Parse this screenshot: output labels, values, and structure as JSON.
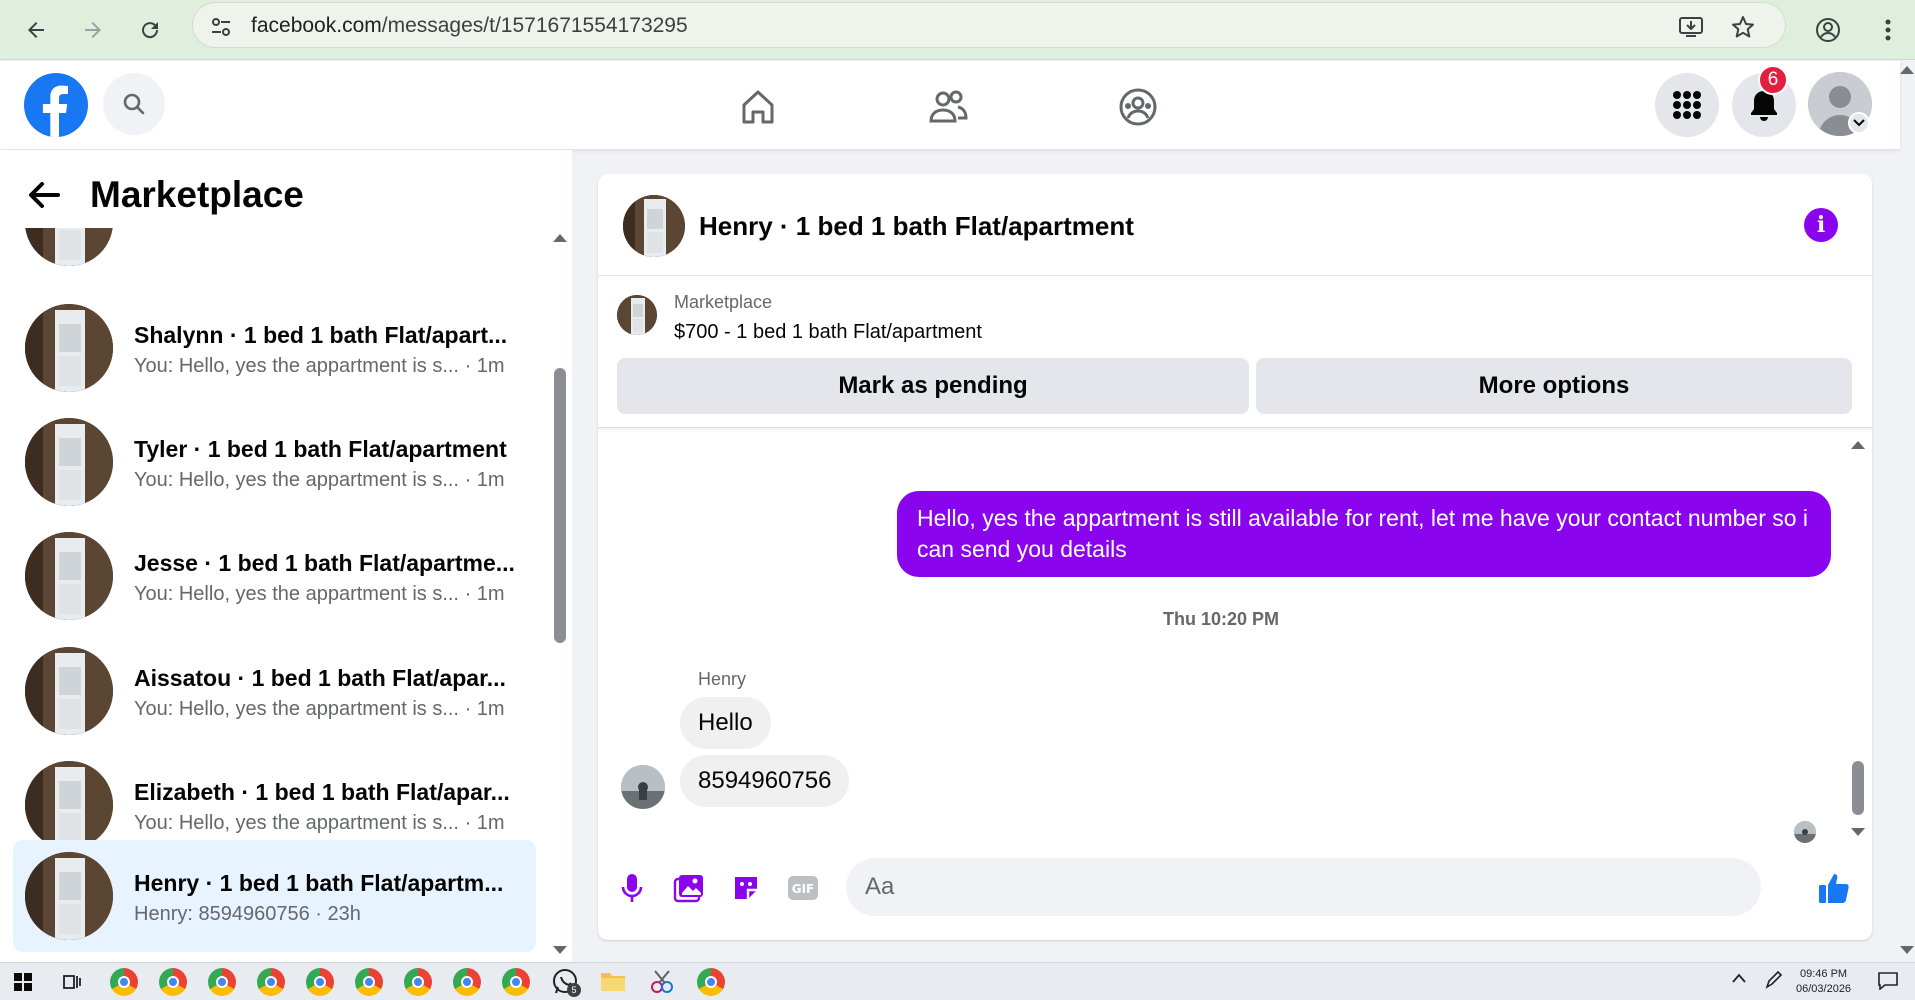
{
  "browser": {
    "url_host": "facebook.com",
    "url_path": "/messages/t/1571671554173295"
  },
  "header": {
    "notification_count": "6"
  },
  "left_panel": {
    "title": "Marketplace",
    "conversations": [
      {
        "name": "Shalynn · 1 bed 1 bath Flat/apart...",
        "preview": "You: Hello, yes the appartment is s...",
        "time": "· 1m"
      },
      {
        "name": "Tyler · 1 bed 1 bath Flat/apartment",
        "preview": "You: Hello, yes the appartment is s...",
        "time": "· 1m"
      },
      {
        "name": "Jesse · 1 bed 1 bath Flat/apartme...",
        "preview": "You: Hello, yes the appartment is s...",
        "time": "· 1m"
      },
      {
        "name": "Aissatou · 1 bed 1 bath Flat/apar...",
        "preview": "You: Hello, yes the appartment is s...",
        "time": "· 1m"
      },
      {
        "name": "Elizabeth · 1 bed 1 bath Flat/apar...",
        "preview": "You: Hello, yes the appartment is s...",
        "time": "· 1m"
      },
      {
        "name": "Henry · 1 bed 1 bath Flat/apartm...",
        "preview": "Henry: 8594960756",
        "time": "· 23h"
      }
    ]
  },
  "chat": {
    "title": "Henry · 1 bed 1 bath Flat/apartment",
    "marketplace_label": "Marketplace",
    "listing_title": "$700 - 1 bed 1 bath Flat/apartment",
    "mark_pending_label": "Mark as pending",
    "more_options_label": "More options",
    "messages": {
      "outgoing": "Hello, yes the appartment is still available for rent, let me have your contact number so i can send you details",
      "timestamp": "Thu 10:20 PM",
      "sender": "Henry",
      "incoming_1": "Hello",
      "incoming_2": "8594960756"
    },
    "composer_placeholder": "Aa"
  },
  "taskbar": {
    "time": "09:46 PM",
    "date": "06/03/2026",
    "whatsapp_badge": "5"
  },
  "colors": {
    "accent": "#8a04ed",
    "brand": "#1877f2"
  }
}
